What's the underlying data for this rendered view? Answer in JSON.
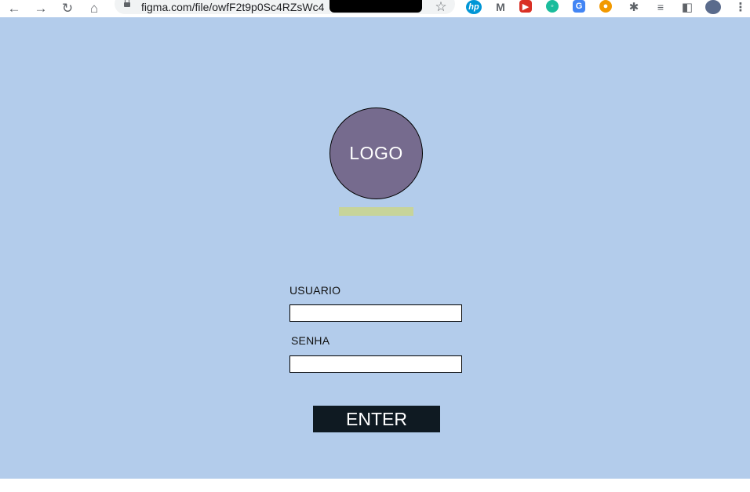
{
  "browser": {
    "url": "figma.com/file/owfF2t9p0Sc4RZsWc4",
    "icons": [
      "back-arrow-icon",
      "forward-arrow-icon",
      "reload-icon",
      "home-icon",
      "lock-icon",
      "star-icon",
      "hp-icon",
      "gmail-icon",
      "extension-red-icon",
      "extension-green-icon",
      "translate-icon",
      "extension-orange-icon",
      "puzzle-icon",
      "reading-list-icon",
      "sidepanel-icon",
      "profile-avatar-icon",
      "kebab-menu-icon"
    ]
  },
  "login": {
    "logo_text": "LOGO",
    "user_label": "USUARIO",
    "user_value": "",
    "password_label": "SENHA",
    "password_value": "",
    "enter_label": "ENTER"
  },
  "colors": {
    "canvas_bg": "#b3cceb",
    "logo_fill": "#766b8e",
    "logo_bar": "#c7d49a",
    "button_bg": "#0f1a22"
  }
}
